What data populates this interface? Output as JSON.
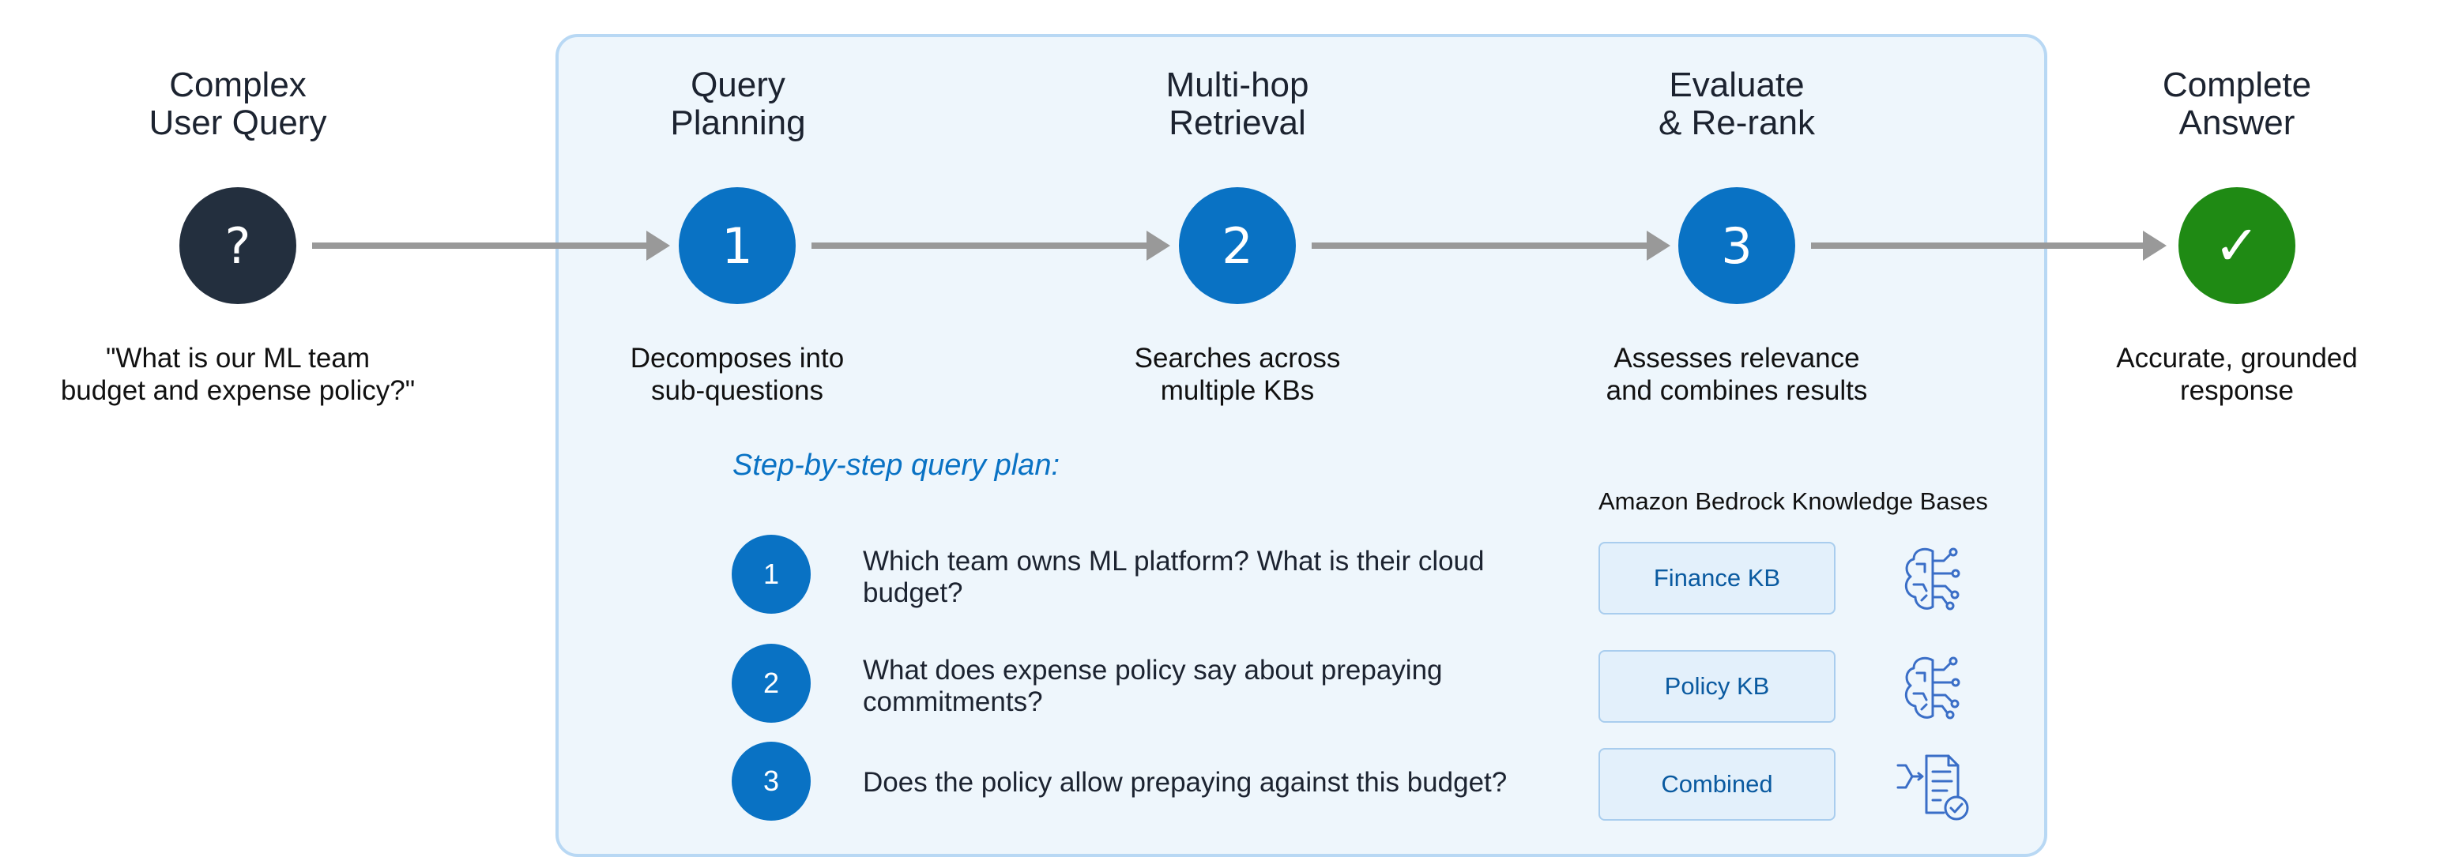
{
  "stages": [
    {
      "title_lines": [
        "Complex",
        "User Query"
      ],
      "symbol": "?",
      "desc_lines": [
        "\"What is our ML team",
        "budget and expense policy?\""
      ],
      "color": "#232f3e"
    },
    {
      "title_lines": [
        "Query",
        "Planning"
      ],
      "symbol": "1",
      "desc_lines": [
        "Decomposes into",
        "sub-questions"
      ],
      "color": "#0972c4"
    },
    {
      "title_lines": [
        "Multi-hop",
        "Retrieval"
      ],
      "symbol": "2",
      "desc_lines": [
        "Searches across",
        "multiple KBs"
      ],
      "color": "#0972c4"
    },
    {
      "title_lines": [
        "Evaluate",
        "& Re-rank"
      ],
      "symbol": "3",
      "desc_lines": [
        "Assesses relevance",
        "and combines results"
      ],
      "color": "#0972c4"
    },
    {
      "title_lines": [
        "Complete",
        "Answer"
      ],
      "symbol": "✓",
      "desc_lines": [
        "Accurate, grounded",
        "response"
      ],
      "color": "#1f8a14"
    }
  ],
  "plan": {
    "title": "Step-by-step query plan:",
    "kb_heading": "Amazon Bedrock Knowledge Bases",
    "steps": [
      {
        "number": "1",
        "text": "Which team owns ML platform? What is their cloud budget?",
        "kb": "Finance KB",
        "icon": "brain-network-icon"
      },
      {
        "number": "2",
        "text": "What does expense policy say about prepaying commitments?",
        "kb": "Policy KB",
        "icon": "brain-network-icon"
      },
      {
        "number": "3",
        "text": "Does the policy allow prepaying against this budget?",
        "kb": "Combined",
        "icon": "merge-document-check-icon"
      }
    ]
  },
  "colors": {
    "panel_bg": "#eef6fc",
    "panel_border": "#b8d8f4",
    "arrow": "#999999",
    "accent_blue": "#0972c4"
  }
}
